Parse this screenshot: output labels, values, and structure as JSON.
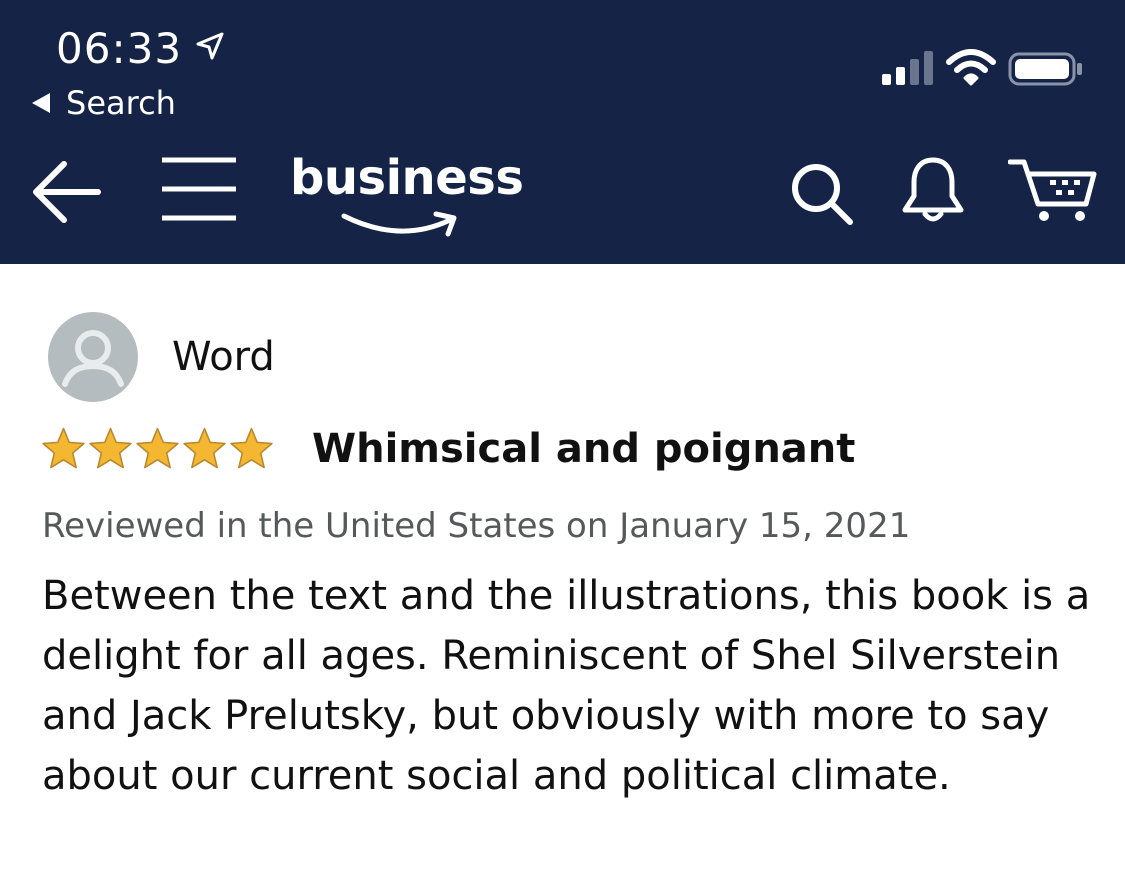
{
  "status_bar": {
    "time": "06:33",
    "back_label": "Search",
    "icons": [
      "location-arrow-icon",
      "cellular-signal-icon",
      "wifi-icon",
      "battery-icon"
    ]
  },
  "navbar": {
    "logo_text": "business",
    "icons": [
      "back-arrow-icon",
      "hamburger-menu-icon",
      "search-icon",
      "bell-icon",
      "cart-icon"
    ],
    "background_color": "#152347"
  },
  "review": {
    "reviewer_name": "Word",
    "rating": 5,
    "rating_max": 5,
    "title": "Whimsical and poignant",
    "meta": "Reviewed in the United States on January 15, 2021",
    "body": "Between the text and the illustrations, this book is a delight for all ages. Reminiscent of Shel Silverstein and Jack Prelutsky, but obviously with more to say about our current social and political climate.",
    "star_color": "#F4B731"
  }
}
